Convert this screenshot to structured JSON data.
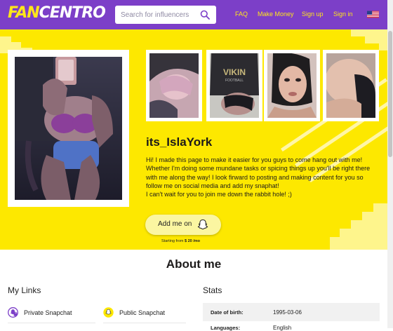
{
  "header": {
    "logo_fan": "FAN",
    "logo_centro": "CENTRO",
    "search_placeholder": "Search for influencers",
    "nav": [
      "FAQ",
      "Make Money",
      "Sign up",
      "Sign in"
    ],
    "language_flag_icon": "us-flag-icon"
  },
  "profile": {
    "username": "its_IslaYork",
    "bio": [
      "Hi! I made this page to make it easier for you guys to come hang out with me!",
      "Whether I'm doing some mundane tasks or spicing things up you'll be right there",
      "with me along the way! I look firward to posting and making content for you so",
      "follow me on social media and add my snaphat!",
      "I can't wait for you to join me down the rabbit hole! ;)"
    ],
    "cta_label": "Add me on",
    "cta_icon": "snapchat-ghost-icon",
    "starting_prefix": "Starting from",
    "starting_price": "$ 20 /mo",
    "thumb_texts": [
      "VIKIN",
      "FOOTBALL"
    ]
  },
  "about": {
    "title": "About me",
    "links_title": "My Links",
    "links": [
      {
        "label": "Private Snapchat",
        "icon": "snapchat-lock-icon"
      },
      {
        "label": "Public Snapchat",
        "icon": "snapchat-ghost-icon"
      }
    ],
    "stats_title": "Stats",
    "stats": [
      {
        "label": "Date of birth:",
        "value": "1995-03-06"
      },
      {
        "label": "Languages:",
        "value": "English"
      }
    ]
  },
  "colors": {
    "header": "#7c3fc8",
    "hero": "#fde800",
    "accent_yellow": "#ffe61a"
  }
}
